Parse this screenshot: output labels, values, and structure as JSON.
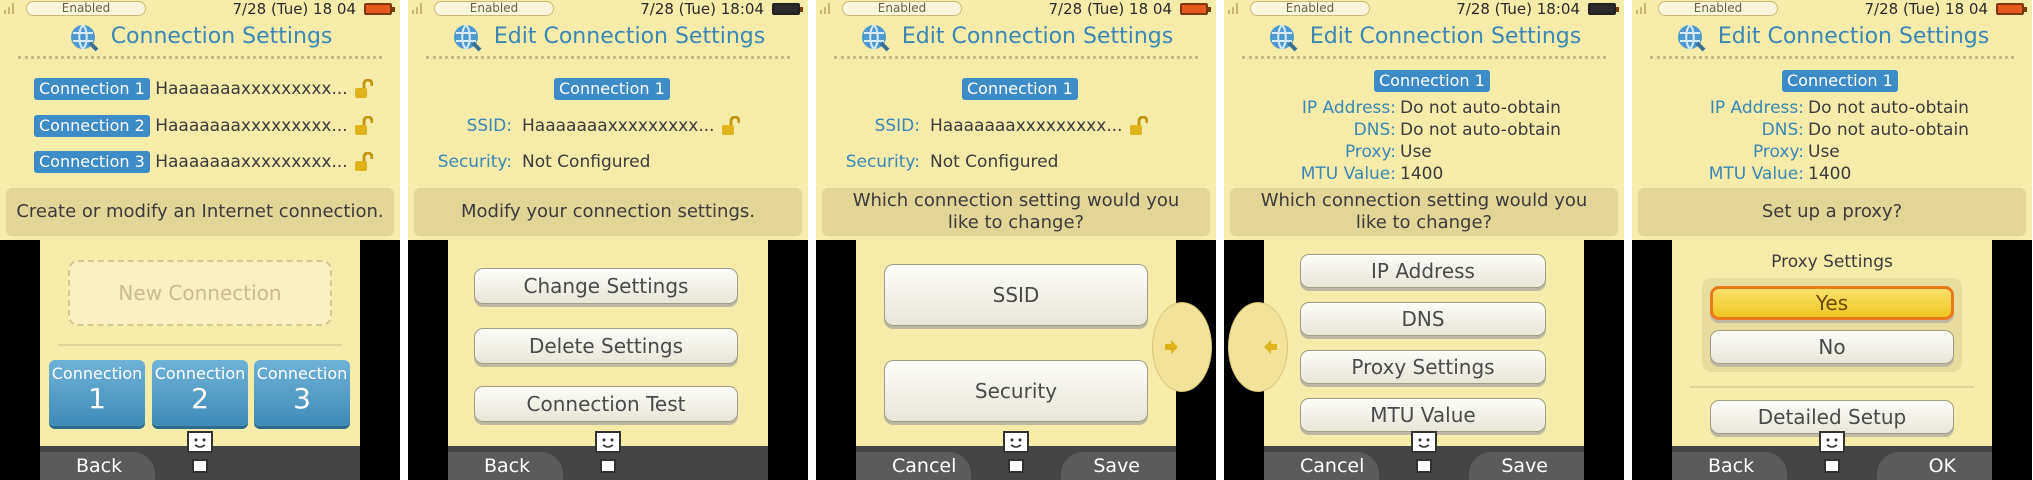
{
  "status": {
    "enabled_label": "Enabled",
    "panels_time": [
      "7/28 (Tue) 18 04",
      "7/28 (Tue) 18:04",
      "7/28 (Tue) 18 04",
      "7/28 (Tue) 18:04",
      "7/28 (Tue) 18 04"
    ]
  },
  "colors": {
    "accent": "#3a86b6",
    "background": "#f6ecaa",
    "tag": "#3d8bc7",
    "battery": "#e8581d"
  },
  "screen1": {
    "title": "Connection Settings",
    "connections": [
      {
        "tag": "Connection 1",
        "name": "Haaaaaaaxxxxxxxxx..."
      },
      {
        "tag": "Connection 2",
        "name": "Haaaaaaaxxxxxxxxx..."
      },
      {
        "tag": "Connection 3",
        "name": "Haaaaaaaxxxxxxxxx..."
      }
    ],
    "message": "Create or modify an Internet connection.",
    "new_connection": "New Connection",
    "tiles": [
      {
        "label": "Connection",
        "num": "1"
      },
      {
        "label": "Connection",
        "num": "2"
      },
      {
        "label": "Connection",
        "num": "3"
      }
    ],
    "left_btn": "Back"
  },
  "screen2": {
    "title": "Edit Connection Settings",
    "tag": "Connection 1",
    "ssid_label": "SSID:",
    "ssid_value": "Haaaaaaaxxxxxxxxx...",
    "security_label": "Security:",
    "security_value": "Not Configured",
    "message": "Modify your connection settings.",
    "buttons": [
      "Change Settings",
      "Delete Settings",
      "Connection Test"
    ],
    "left_btn": "Back"
  },
  "screen3": {
    "title": "Edit Connection Settings",
    "tag": "Connection 1",
    "ssid_label": "SSID:",
    "ssid_value": "Haaaaaaaxxxxxxxxx...",
    "security_label": "Security:",
    "security_value": "Not Configured",
    "message": "Which connection setting would you like to change?",
    "buttons": [
      "SSID",
      "Security"
    ],
    "left_btn": "Cancel",
    "right_btn": "Save"
  },
  "screen4": {
    "title": "Edit Connection Settings",
    "tag": "Connection 1",
    "fields": [
      {
        "label": "IP Address:",
        "value": "Do not auto-obtain"
      },
      {
        "label": "DNS:",
        "value": "Do not auto-obtain"
      },
      {
        "label": "Proxy:",
        "value": "Use"
      },
      {
        "label": "MTU Value:",
        "value": "1400"
      }
    ],
    "message": "Which connection setting would you like to change?",
    "buttons": [
      "IP Address",
      "DNS",
      "Proxy Settings",
      "MTU Value"
    ],
    "left_btn": "Cancel",
    "right_btn": "Save"
  },
  "screen5": {
    "title": "Edit Connection Settings",
    "tag": "Connection 1",
    "fields": [
      {
        "label": "IP Address:",
        "value": "Do not auto-obtain"
      },
      {
        "label": "DNS:",
        "value": "Do not auto-obtain"
      },
      {
        "label": "Proxy:",
        "value": "Use"
      },
      {
        "label": "MTU Value:",
        "value": "1400"
      }
    ],
    "message": "Set up a proxy?",
    "proxy_heading": "Proxy Settings",
    "yes": "Yes",
    "no": "No",
    "detailed": "Detailed Setup",
    "left_btn": "Back",
    "right_btn": "OK"
  }
}
